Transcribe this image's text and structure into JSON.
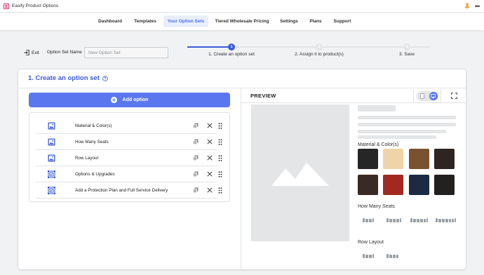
{
  "app": {
    "title": "Easify Product Options",
    "pin_icon": "pin-icon",
    "more_icon": "more-horizontal-icon",
    "brand_color": "#e0245e"
  },
  "nav": {
    "tabs": [
      {
        "label": "Dashboard",
        "active": false
      },
      {
        "label": "Templates",
        "active": false
      },
      {
        "label": "Your Option Sets",
        "active": true
      },
      {
        "label": "Tiered Wholesale Pricing",
        "active": false
      },
      {
        "label": "Settings",
        "active": false
      },
      {
        "label": "Plans",
        "active": false
      },
      {
        "label": "Support",
        "active": false
      }
    ]
  },
  "header": {
    "exit_label": "Exit",
    "option_set_name_label": "Option Set Name",
    "option_set_name_value": "",
    "option_set_name_placeholder": "New Option Set"
  },
  "stepper": {
    "steps": [
      {
        "number": "1",
        "label": "1. Create an option set",
        "active": true
      },
      {
        "number": "2",
        "label": "2. Assign it to product(s)",
        "active": false
      },
      {
        "number": "3",
        "label": "3. Save",
        "active": false
      }
    ],
    "accent": "#3c5bd9"
  },
  "card": {
    "title": "1. Create an option set",
    "add_option_label": "Add option",
    "options": [
      {
        "label": "Material & Color(s)",
        "icon": "image-swatch-icon"
      },
      {
        "label": "How Many Seats",
        "icon": "image-swatch-icon"
      },
      {
        "label": "Row Layout",
        "icon": "image-swatch-icon"
      },
      {
        "label": "Options & Upgrades",
        "icon": "checkbox-group-icon"
      },
      {
        "label": "Add a Protection Plan and Full Service Delivery",
        "icon": "checkbox-group-icon"
      }
    ]
  },
  "preview": {
    "title": "PREVIEW",
    "sections": {
      "material": "Material & Color(s)",
      "seats": "How Many Seats",
      "row_layout": "Row Layout"
    },
    "swatch_colors": [
      "#262626",
      "#efd3a9",
      "#7b5230",
      "#2e2421",
      "#3a2a24",
      "#a1291f",
      "#1c2a44",
      "#222120"
    ],
    "accent": "#5b77ef"
  }
}
